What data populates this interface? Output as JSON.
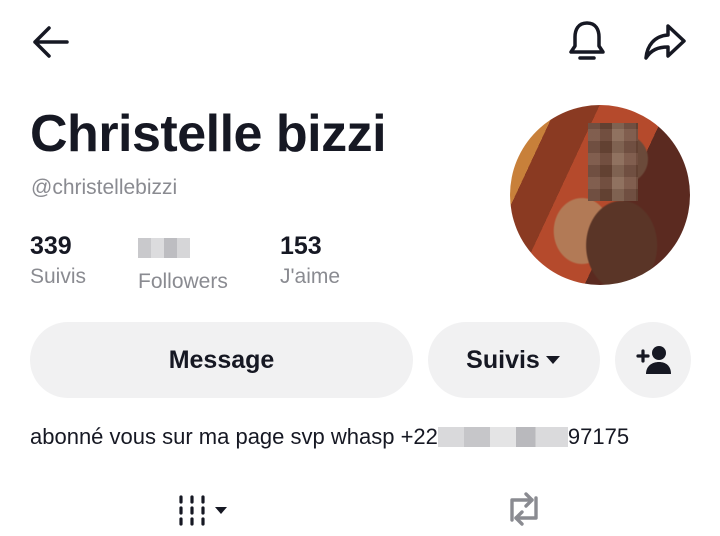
{
  "header": {
    "back_icon": "arrow-left-icon",
    "notification_icon": "bell-icon",
    "share_icon": "share-arrow-icon"
  },
  "profile": {
    "display_name": "Christelle bizzi",
    "handle": "@christellebizzi",
    "avatar_icon": "profile-photo"
  },
  "stats": {
    "following": {
      "value": "339",
      "label": "Suivis"
    },
    "followers": {
      "label": "Followers"
    },
    "likes": {
      "value": "153",
      "label": "J'aime"
    }
  },
  "actions": {
    "message_label": "Message",
    "following_label": "Suivis",
    "following_icon": "caret-down-icon",
    "add_friend_icon": "add-user-icon"
  },
  "bio": {
    "text_start": "abonné vous sur ma page svp whasp +22",
    "text_end": "97175"
  },
  "tabs": {
    "videos_icon": "grid-icon",
    "reposts_icon": "repost-icon"
  },
  "colors": {
    "text": "#161823",
    "secondary_text": "#8a8b91",
    "button_bg": "#f1f1f2",
    "background": "#ffffff"
  }
}
